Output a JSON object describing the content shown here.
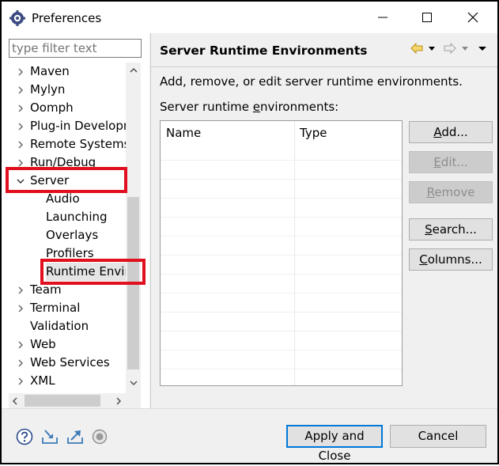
{
  "window": {
    "title": "Preferences"
  },
  "left": {
    "filter_placeholder": "type filter text",
    "tree": [
      {
        "label": "Maven",
        "expand": "collapsed",
        "indent": 0
      },
      {
        "label": "Mylyn",
        "expand": "collapsed",
        "indent": 0
      },
      {
        "label": "Oomph",
        "expand": "collapsed",
        "indent": 0
      },
      {
        "label": "Plug-in Developm",
        "expand": "collapsed",
        "indent": 0
      },
      {
        "label": "Remote Systems",
        "expand": "collapsed",
        "indent": 0
      },
      {
        "label": "Run/Debug",
        "expand": "collapsed",
        "indent": 0
      },
      {
        "label": "Server",
        "expand": "expanded",
        "indent": 0
      },
      {
        "label": "Audio",
        "expand": "none",
        "indent": 1
      },
      {
        "label": "Launching",
        "expand": "none",
        "indent": 1
      },
      {
        "label": "Overlays",
        "expand": "none",
        "indent": 1
      },
      {
        "label": "Profilers",
        "expand": "none",
        "indent": 1
      },
      {
        "label": "Runtime Enviro",
        "expand": "none",
        "indent": 1,
        "selected": true
      },
      {
        "label": "Team",
        "expand": "collapsed",
        "indent": 0
      },
      {
        "label": "Terminal",
        "expand": "collapsed",
        "indent": 0
      },
      {
        "label": "Validation",
        "expand": "none",
        "indent": 0
      },
      {
        "label": "Web",
        "expand": "collapsed",
        "indent": 0
      },
      {
        "label": "Web Services",
        "expand": "collapsed",
        "indent": 0
      },
      {
        "label": "XML",
        "expand": "collapsed",
        "indent": 0
      }
    ]
  },
  "right": {
    "title": "Server Runtime Environments",
    "description": "Add, remove, or edit server runtime environments.",
    "list_label": "Server runtime environments:",
    "columns": [
      "Name",
      "Type"
    ],
    "buttons": {
      "add": "Add...",
      "edit": "Edit...",
      "remove": "Remove",
      "search": "Search...",
      "columns": "Columns..."
    }
  },
  "footer": {
    "apply_close": "Apply and Close",
    "cancel": "Cancel"
  },
  "colors": {
    "highlight": "#e0101e",
    "accent": "#0078d7"
  }
}
